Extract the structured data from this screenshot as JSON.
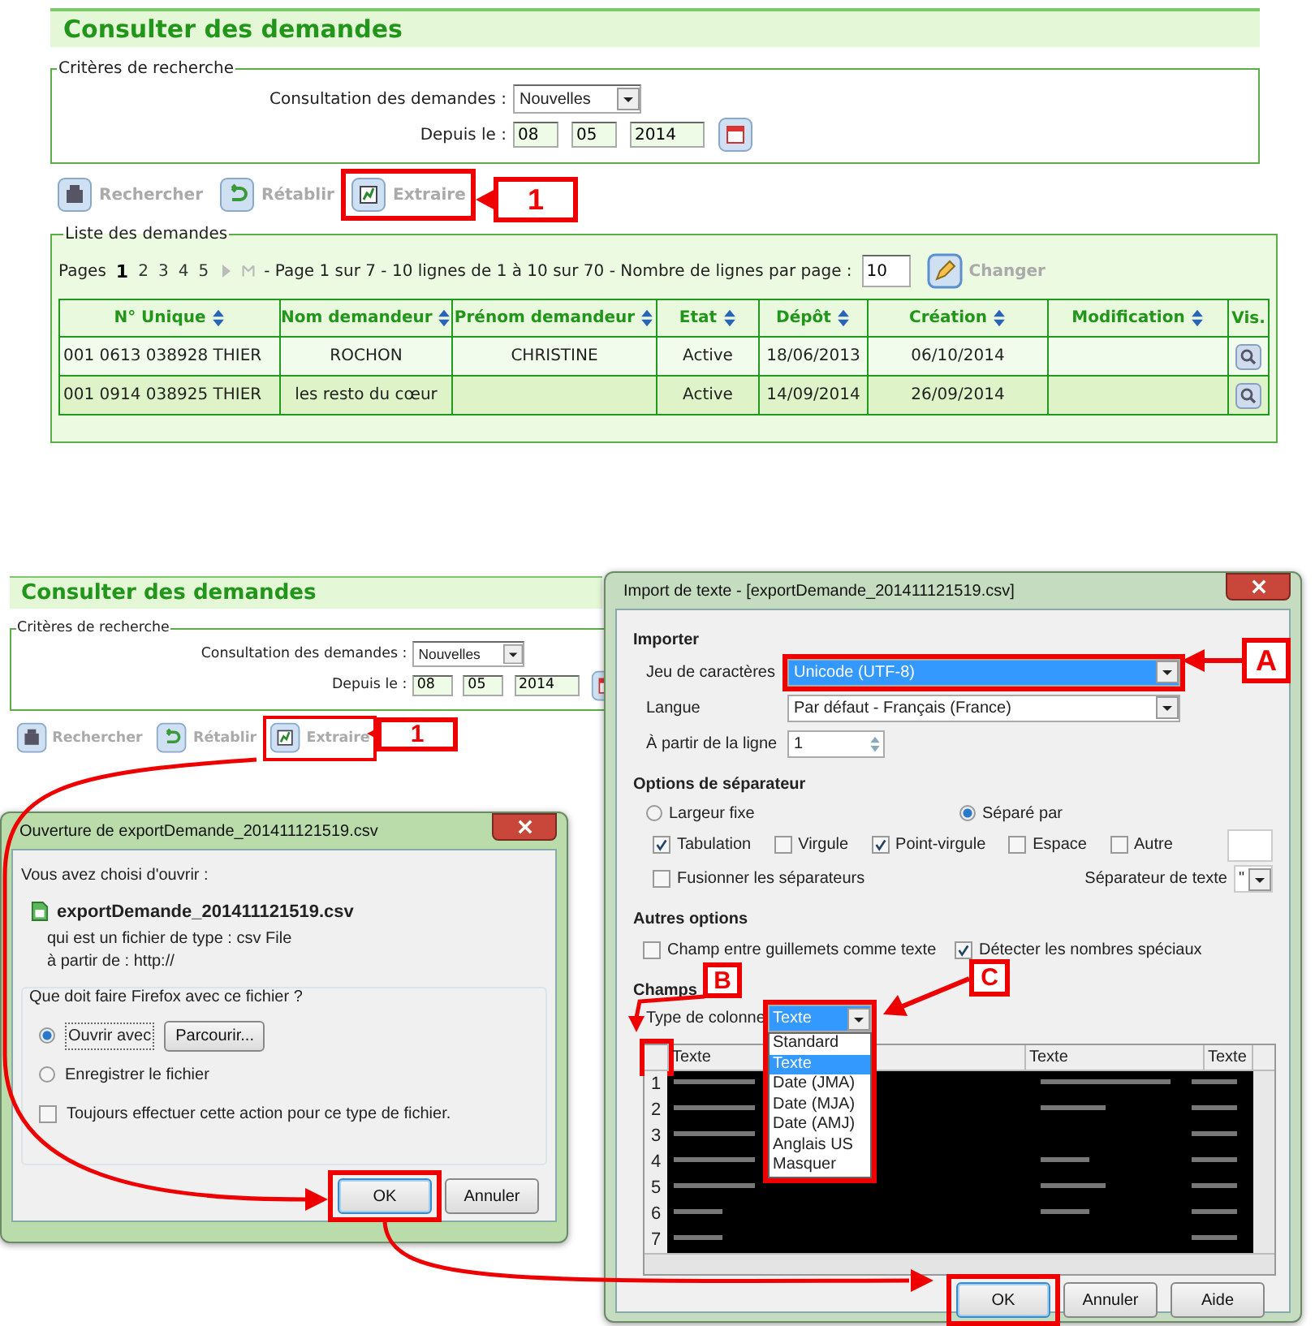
{
  "pages": [
    {
      "title": "Consulter des demandes",
      "criteria": {
        "legend": "Critères de recherche",
        "consultation_label": "Consultation des demandes :",
        "consultation_value": "Nouvelles",
        "date_label": "Depuis le :",
        "day": "08",
        "month": "05",
        "year": "2014"
      },
      "toolbar": [
        {
          "label": "Rechercher"
        },
        {
          "label": "Rétablir"
        },
        {
          "label": "Extraire"
        }
      ],
      "list": {
        "legend": "Liste des demandes",
        "pages_label": "Pages",
        "pages": [
          {
            "label": "1",
            "selected": true
          },
          {
            "label": "2",
            "selected": false
          },
          {
            "label": "3",
            "selected": false
          },
          {
            "label": "4",
            "selected": false
          },
          {
            "label": "5",
            "selected": false
          }
        ],
        "summary": "- Page 1 sur 7 - 10 lignes de 1 à 10 sur 70 - Nombre de lignes par page :",
        "per_page": "10",
        "change_label": "Changer",
        "columns": [
          "N° Unique",
          "Nom demandeur",
          "Prénom demandeur",
          "Etat",
          "Dépôt",
          "Création",
          "Modification",
          "Vis."
        ],
        "rows": [
          {
            "numero": "001 0613 038928 THIER",
            "nom": "ROCHON",
            "prenom": "CHRISTINE",
            "etat": "Active",
            "depot": "18/06/2013",
            "creation": "06/10/2014"
          },
          {
            "numero": "001 0914 038925 THIER",
            "nom": "les resto du cœur",
            "etat": "Active",
            "depot": "14/09/2014",
            "creation": "26/09/2014"
          }
        ]
      }
    },
    {
      "title": "Consulter des demandes",
      "criteria": {
        "legend": "Critères de recherche",
        "consultation_label": "Consultation des demandes :",
        "consultation_value": "Nouvelles",
        "date_label": "Depuis le :",
        "day": "08",
        "month": "05",
        "year": "2014"
      },
      "toolbar": [
        {
          "label": "Rechercher"
        },
        {
          "label": "Rétablir"
        },
        {
          "label": "Extraire"
        }
      ]
    }
  ],
  "open_dialog": {
    "title": "Ouverture de exportDemande_201411121519.csv",
    "intro": "Vous avez choisi d'ouvrir :",
    "filename": "exportDemande_201411121519.csv",
    "type_line": "qui est un fichier de type : csv File",
    "source_line": "à partir de : http://",
    "question": "Que doit faire Firefox avec ce fichier ?",
    "actions": [
      {
        "label": "Ouvrir avec",
        "selected": true
      },
      {
        "label": "Enregistrer le fichier",
        "selected": false
      }
    ],
    "browse_label": "Parcourir...",
    "always": {
      "label": "Toujours effectuer cette action pour ce type de fichier.",
      "checked": false
    },
    "buttons": [
      {
        "label": "OK",
        "default": true
      },
      {
        "label": "Annuler",
        "default": false
      }
    ]
  },
  "import_dialog": {
    "title": "Import de texte - [exportDemande_201411121519.csv]",
    "importer": {
      "heading": "Importer",
      "charset_label": "Jeu de caractères",
      "charset": "Unicode (UTF-8)",
      "language_label": "Langue",
      "language": "Par défaut - Français (France)",
      "from_row_label": "À partir de la ligne",
      "from_row": "1"
    },
    "separator": {
      "heading": "Options de séparateur",
      "modes": [
        {
          "label": "Largeur fixe",
          "selected": false
        },
        {
          "label": "Séparé par",
          "selected": true
        }
      ],
      "separators": [
        {
          "label": "Tabulation",
          "checked": true
        },
        {
          "label": "Virgule",
          "checked": false
        },
        {
          "label": "Point-virgule",
          "checked": true
        },
        {
          "label": "Espace",
          "checked": false
        },
        {
          "label": "Autre",
          "checked": false
        }
      ],
      "merge": {
        "label": "Fusionner les séparateurs",
        "checked": false
      },
      "text_separator_label": "Séparateur de texte",
      "text_separator": "\""
    },
    "other": {
      "heading": "Autres options",
      "options": [
        {
          "label": "Champ entre guillemets comme texte",
          "checked": false
        },
        {
          "label": "Détecter les nombres spéciaux",
          "checked": true
        }
      ]
    },
    "fields": {
      "heading": "Champs",
      "column_type_label": "Type de colonne",
      "column_type": "Texte",
      "type_options": [
        {
          "label": "Standard",
          "selected": false
        },
        {
          "label": "Texte",
          "selected": true
        },
        {
          "label": "Date (JMA)",
          "selected": false
        },
        {
          "label": "Date (MJA)",
          "selected": false
        },
        {
          "label": "Date (AMJ)",
          "selected": false
        },
        {
          "label": "Anglais US",
          "selected": false
        },
        {
          "label": "Masquer",
          "selected": false
        }
      ],
      "headers": [
        "Texte",
        "Texte",
        "Texte"
      ],
      "row_numbers": [
        "1",
        "2",
        "3",
        "4",
        "5",
        "6",
        "7"
      ]
    },
    "buttons": [
      {
        "label": "OK",
        "default": true
      },
      {
        "label": "Annuler",
        "default": false
      },
      {
        "label": "Aide",
        "default": false
      }
    ]
  },
  "callouts": [
    {
      "label": "1"
    },
    {
      "label": "1"
    },
    {
      "label": "A"
    },
    {
      "label": "B"
    },
    {
      "label": "C"
    }
  ]
}
